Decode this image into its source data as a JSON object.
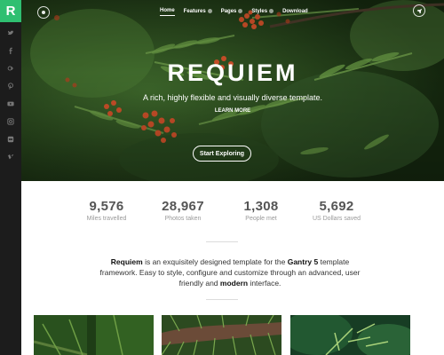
{
  "brand": {
    "logo_letter": "R"
  },
  "sidebar": {
    "social": [
      {
        "name": "twitter-icon"
      },
      {
        "name": "facebook-icon"
      },
      {
        "name": "google-plus-icon"
      },
      {
        "name": "pinterest-icon"
      },
      {
        "name": "youtube-icon"
      },
      {
        "name": "instagram-icon"
      },
      {
        "name": "flickr-icon"
      },
      {
        "name": "vimeo-icon"
      }
    ]
  },
  "nav": {
    "items": [
      {
        "label": "Home",
        "active": true,
        "has_dropdown": false
      },
      {
        "label": "Features",
        "active": false,
        "has_dropdown": true
      },
      {
        "label": "Pages",
        "active": false,
        "has_dropdown": true
      },
      {
        "label": "Styles",
        "active": false,
        "has_dropdown": true
      },
      {
        "label": "Download",
        "active": false,
        "has_dropdown": false
      }
    ]
  },
  "hero": {
    "title": "REQUIEM",
    "subtitle": "A rich, highly flexible and visually diverse template.",
    "link": "LEARN MORE",
    "cta": "Start Exploring"
  },
  "stats": [
    {
      "value": "9,576",
      "label": "Miles travelled"
    },
    {
      "value": "28,967",
      "label": "Photos taken"
    },
    {
      "value": "1,308",
      "label": "People met"
    },
    {
      "value": "5,692",
      "label": "US Dollars saved"
    }
  ],
  "intro": {
    "brand": "Requiem",
    "text1": " is an exquisitely designed template for the ",
    "product": "Gantry 5",
    "text2": " template framework. Easy to style, configure and customize through an advanced, user friendly and ",
    "emphasis": "modern",
    "text3": " interface."
  },
  "colors": {
    "accent": "#2fbf71",
    "sidebar": "#1c1c1c",
    "text": "#333333"
  }
}
